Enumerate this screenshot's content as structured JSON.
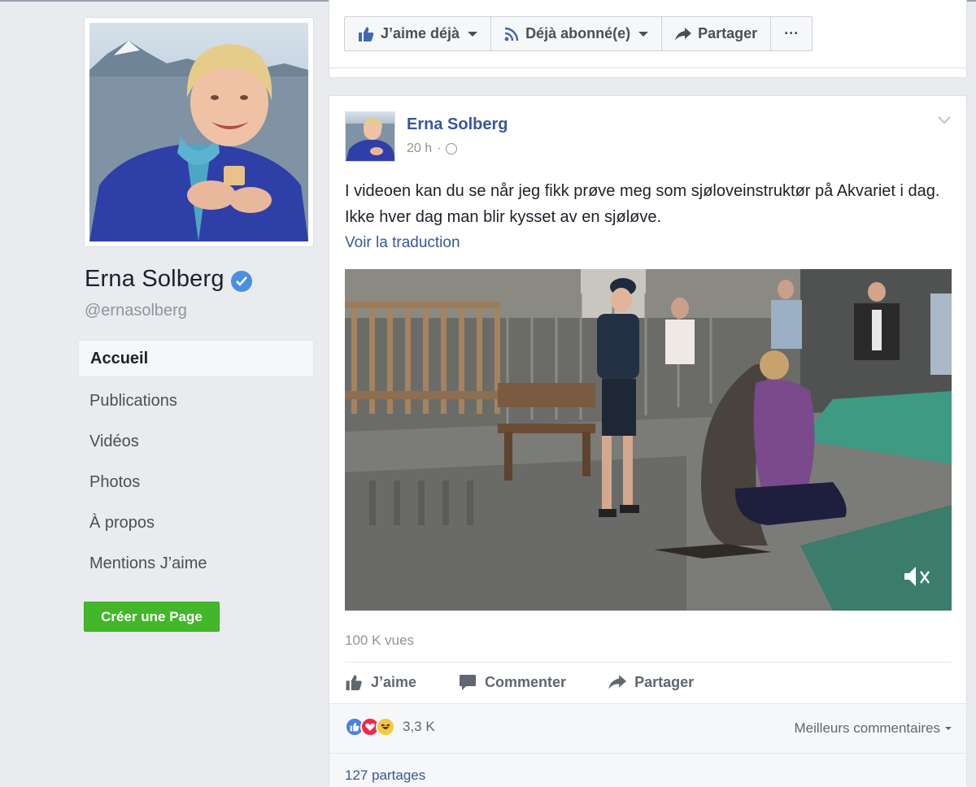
{
  "page": {
    "name": "Erna Solberg",
    "handle": "@ernasolberg",
    "verified": true
  },
  "sidebar": {
    "items": [
      {
        "label": "Accueil",
        "active": true
      },
      {
        "label": "Publications"
      },
      {
        "label": "Vidéos"
      },
      {
        "label": "Photos"
      },
      {
        "label": "À propos"
      },
      {
        "label": "Mentions J’aime"
      }
    ],
    "create_page_label": "Créer une Page"
  },
  "action_bar": {
    "like_label": "J’aime déjà",
    "follow_label": "Déjà abonné(e)",
    "share_label": "Partager",
    "more_label": "···"
  },
  "post": {
    "author": "Erna Solberg",
    "time": "20 h",
    "separator": "·",
    "text": "I videoen kan du se når jeg fikk prøve meg som sjøloveinstruktør på Akvariet i dag. Ikke hver dag man blir kysset av en sjøløve.",
    "translate_label": "Voir la traduction",
    "views": "100 K vues",
    "actions": {
      "like": "J’aime",
      "comment": "Commenter",
      "share": "Partager"
    },
    "reactions_count": "3,3 K",
    "sort_label": "Meilleurs commentaires",
    "shares": "127 partages"
  },
  "colors": {
    "brand_blue": "#4267b2",
    "link_blue": "#365899",
    "green": "#42b72a",
    "verified": "#4a90e2"
  }
}
